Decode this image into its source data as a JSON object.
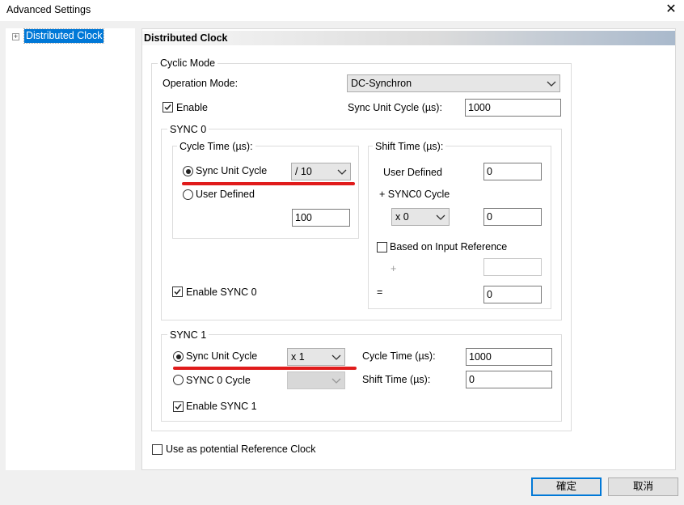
{
  "window": {
    "title": "Advanced Settings",
    "close_glyph": "✕"
  },
  "tree": {
    "expander": "+",
    "item_label": "Distributed Clock"
  },
  "panel": {
    "header": "Distributed Clock"
  },
  "cyclic_mode": {
    "legend": "Cyclic Mode",
    "operation_mode_label": "Operation Mode:",
    "operation_mode_value": "DC-Synchron",
    "enable_label": "Enable",
    "enable_checked": true,
    "sync_unit_cycle_label": "Sync Unit Cycle (µs):",
    "sync_unit_cycle_value": "1000"
  },
  "sync0": {
    "legend": "SYNC 0",
    "cycle_time": {
      "legend": "Cycle Time (µs):",
      "sync_unit_cycle_label": "Sync Unit Cycle",
      "sync_unit_cycle_selected": true,
      "divider_value": "/ 10",
      "user_defined_label": "User Defined",
      "user_defined_value": "100"
    },
    "shift_time": {
      "legend": "Shift Time (µs):",
      "user_defined_label": "User Defined",
      "user_defined_value": "0",
      "sync0_cycle_label": "+ SYNC0 Cycle",
      "multiplier_value": "x 0",
      "multiplier_result": "0",
      "based_on_input_label": "Based on Input Reference",
      "based_on_input_checked": false,
      "plus_label": "+",
      "plus_value": "",
      "equals_label": "=",
      "equals_value": "0"
    },
    "enable_label": "Enable SYNC 0",
    "enable_checked": true
  },
  "sync1": {
    "legend": "SYNC 1",
    "sync_unit_cycle_label": "Sync Unit Cycle",
    "sync_unit_cycle_selected": true,
    "multiplier_value": "x 1",
    "sync0_cycle_label": "SYNC 0 Cycle",
    "sync0_cycle_value": "",
    "cycle_time_label": "Cycle Time (µs):",
    "cycle_time_value": "1000",
    "shift_time_label": "Shift Time (µs):",
    "shift_time_value": "0",
    "enable_label": "Enable SYNC 1",
    "enable_checked": true
  },
  "reference_clock": {
    "label": "Use as potential Reference Clock",
    "checked": false
  },
  "buttons": {
    "ok_label": "確定",
    "cancel_label": "取消"
  },
  "annotation": {
    "highlight_color": "#e01b1b"
  }
}
